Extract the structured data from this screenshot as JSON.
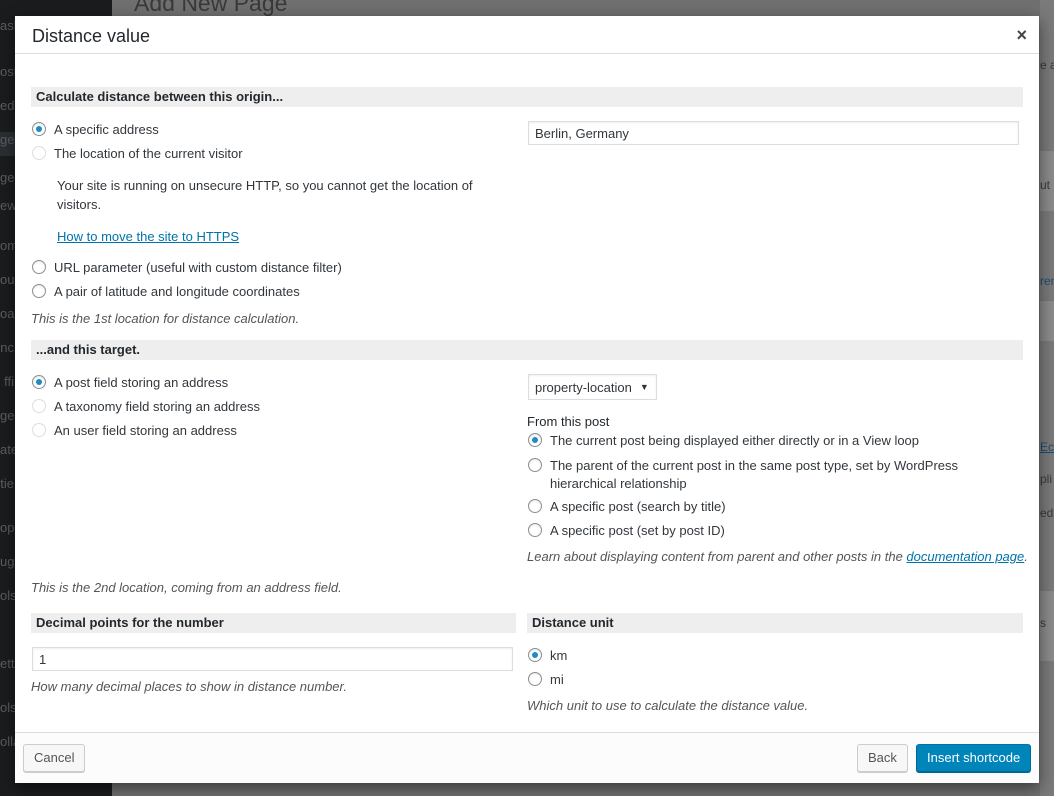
{
  "background": {
    "page_title": "Add New Page",
    "sidebar_fragments": [
      "ash",
      "ost",
      "edi",
      "ge",
      "ges",
      "ew",
      "om",
      "ou",
      "oa",
      "nc",
      "ffi",
      "ge",
      "ate",
      "tie",
      "op",
      "ug",
      "ols",
      "etti",
      "ols",
      "olla"
    ],
    "right_fragments": [
      "e a",
      "ut",
      "ren",
      "Ec",
      "pli",
      "ed",
      "s"
    ]
  },
  "dialog": {
    "title": "Distance value",
    "close_symbol": "×"
  },
  "origin": {
    "heading": "Calculate distance between this origin...",
    "options": [
      {
        "label": "A specific address",
        "checked": true
      },
      {
        "label": "The location of the current visitor",
        "checked": false,
        "disabled": true
      },
      {
        "label": "URL parameter (useful with custom distance filter)",
        "checked": false
      },
      {
        "label": "A pair of latitude and longitude coordinates",
        "checked": false
      }
    ],
    "https_warning": "Your site is running on unsecure HTTP, so you cannot get the location of visitors.",
    "https_link": "How to move the site to HTTPS",
    "address_value": "Berlin, Germany",
    "hint": "This is the 1st location for distance calculation."
  },
  "target": {
    "heading": "...and this target.",
    "options": [
      {
        "label": "A post field storing an address",
        "checked": true
      },
      {
        "label": "A taxonomy field storing an address",
        "checked": false,
        "disabled": true
      },
      {
        "label": "An user field storing an address",
        "checked": false,
        "disabled": true
      }
    ],
    "field_select": "property-location",
    "from_post_label": "From this post",
    "post_options": [
      {
        "label": "The current post being displayed either directly or in a View loop",
        "checked": true
      },
      {
        "label": "The parent of the current post in the same post type, set by WordPress hierarchical relationship",
        "checked": false
      },
      {
        "label": "A specific post (search by title)",
        "checked": false
      },
      {
        "label": "A specific post (set by post ID)",
        "checked": false
      }
    ],
    "learn_text": "Learn about displaying content from parent and other posts in the ",
    "learn_link": "documentation page",
    "learn_end": ".",
    "hint": "This is the 2nd location, coming from an address field."
  },
  "decimals": {
    "heading": "Decimal points for the number",
    "value": "1",
    "hint": "How many decimal places to show in distance number."
  },
  "unit": {
    "heading": "Distance unit",
    "options": [
      {
        "label": "km",
        "checked": true
      },
      {
        "label": "mi",
        "checked": false
      }
    ],
    "hint": "Which unit to use to calculate the distance value."
  },
  "footer": {
    "cancel": "Cancel",
    "back": "Back",
    "insert": "Insert shortcode"
  }
}
